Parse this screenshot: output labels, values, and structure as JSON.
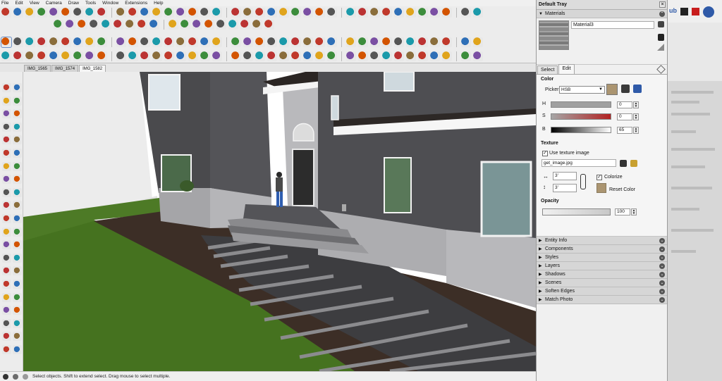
{
  "menubar": {
    "items": [
      {
        "name": "menu-file",
        "label": "File"
      },
      {
        "name": "menu-edit",
        "label": "Edit"
      },
      {
        "name": "menu-view",
        "label": "View"
      },
      {
        "name": "menu-camera",
        "label": "Camera"
      },
      {
        "name": "menu-draw",
        "label": "Draw"
      },
      {
        "name": "menu-tools",
        "label": "Tools"
      },
      {
        "name": "menu-window",
        "label": "Window"
      },
      {
        "name": "menu-extensions",
        "label": "Extensions"
      },
      {
        "name": "menu-help",
        "label": "Help"
      }
    ]
  },
  "scene_tabs": [
    {
      "label": "IMG_1565",
      "active": false
    },
    {
      "label": "IMG_1574",
      "active": false
    },
    {
      "label": "IMG_1582",
      "active": true
    }
  ],
  "status": {
    "text": "Select objects. Shift to extend select. Drag mouse to select multiple."
  },
  "tray": {
    "title": "Default Tray",
    "materials_section": "Materials",
    "material_name": "Material3",
    "tabs": [
      {
        "label": "Select",
        "active": false
      },
      {
        "label": "Edit",
        "active": true
      }
    ],
    "edit": {
      "color_heading": "Color",
      "picker_label": "Picker:",
      "picker_value": "HSB",
      "h_label": "H",
      "h_value": "0",
      "s_label": "S",
      "s_value": "0",
      "b_label": "B",
      "b_value": "65",
      "texture_heading": "Texture",
      "use_texture_label": "Use texture image",
      "use_texture_checked": "✓",
      "texture_file": "get_image.jpg",
      "width_value": "3'",
      "height_value": "3'",
      "colorize_label": "Colorize",
      "colorize_checked": "✓",
      "reset_color_label": "Reset Color",
      "opacity_heading": "Opacity",
      "opacity_value": "100",
      "opacity_level": 1.0
    },
    "sections": [
      "Entity Info",
      "Components",
      "Styles",
      "Layers",
      "Shadows",
      "Scenes",
      "Soften Edges",
      "Match Photo"
    ],
    "swatch_color": "#ab9571"
  },
  "right_strip": {
    "logo_text": "ub"
  },
  "colors": {
    "accent": "#2f5aa8",
    "grass": "#4d7a26",
    "mulch": "#3c2e26",
    "siding": "#4a4a4d",
    "sky": "#ffffff"
  }
}
